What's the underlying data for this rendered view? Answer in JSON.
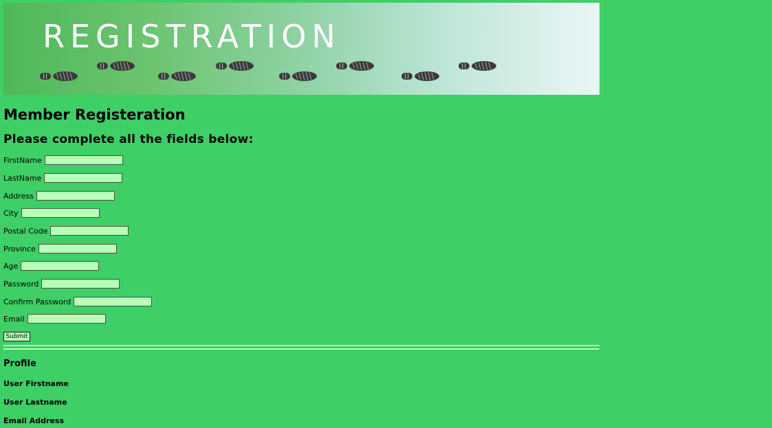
{
  "banner": {
    "title": "REGISTRATION"
  },
  "page_title": "Member Registeration",
  "instructions": "Please complete all the fields below:",
  "form": {
    "fields": [
      {
        "label": "FirstName",
        "value": ""
      },
      {
        "label": "LastName",
        "value": ""
      },
      {
        "label": "Address",
        "value": ""
      },
      {
        "label": "City",
        "value": ""
      },
      {
        "label": "Postal Code",
        "value": ""
      },
      {
        "label": "Province",
        "value": ""
      },
      {
        "label": "Age",
        "value": ""
      },
      {
        "label": "Password",
        "value": ""
      },
      {
        "label": "Confirm Password",
        "value": ""
      },
      {
        "label": "Email",
        "value": ""
      }
    ],
    "submit_label": "Submit"
  },
  "profile": {
    "heading": "Profile",
    "fields": [
      "User Firstname",
      "User Lastname",
      "Email Address"
    ]
  },
  "colors": {
    "background": "#3ecf66",
    "input_fill": "#b8ffb8",
    "footprint": "#3a3a3a"
  },
  "icons": {
    "banner_decoration": "footprints-icon"
  }
}
